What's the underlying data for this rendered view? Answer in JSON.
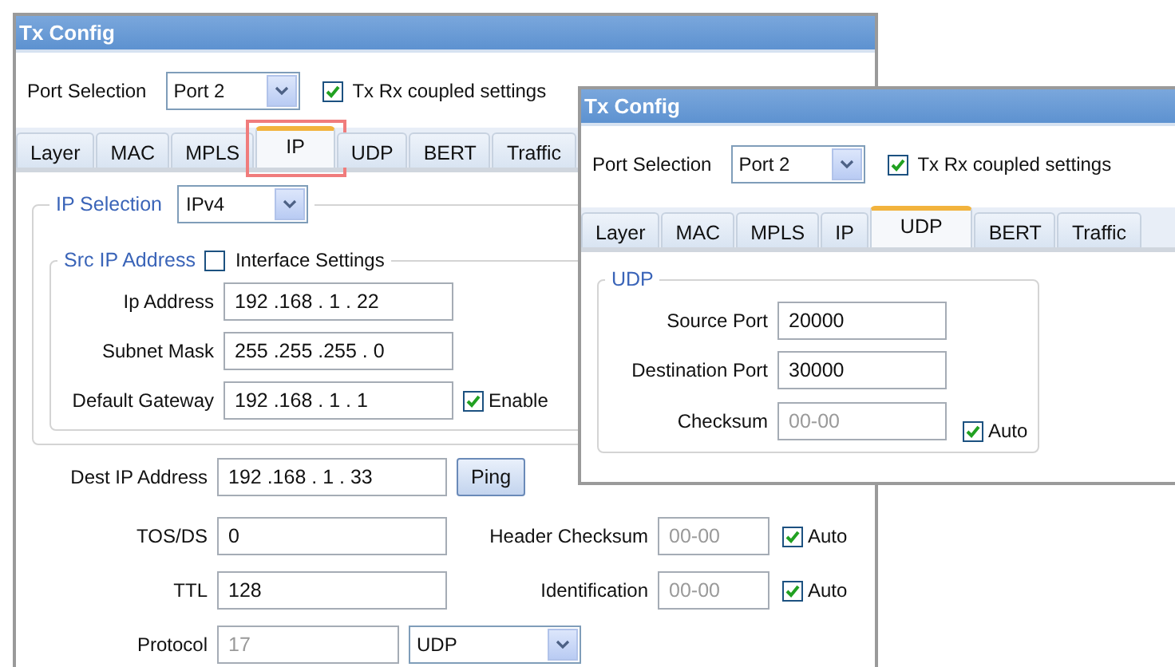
{
  "windows": [
    {
      "title": "Tx Config",
      "port": {
        "label": "Port Selection",
        "value": "Port 2"
      },
      "coupled": {
        "label": "Tx Rx coupled settings",
        "checked": true
      },
      "tabs": [
        {
          "label": "Layer",
          "selected": false
        },
        {
          "label": "MAC",
          "selected": false
        },
        {
          "label": "MPLS",
          "selected": false
        },
        {
          "label": "IP",
          "selected": true
        },
        {
          "label": "UDP",
          "selected": false
        },
        {
          "label": "BERT",
          "selected": false
        },
        {
          "label": "Traffic",
          "selected": false
        }
      ],
      "highlight_selected_tab": true,
      "panel": {
        "kind": "ip",
        "ip_selection": {
          "label": "IP Selection",
          "value": "IPv4"
        },
        "src": {
          "label": "Src IP Address",
          "interface": {
            "label": "Interface Settings",
            "checked": false
          },
          "rows": [
            {
              "label": "Ip Address",
              "value": "192 .168 . 1 . 22"
            },
            {
              "label": "Subnet Mask",
              "value": "255 .255 .255 . 0"
            },
            {
              "label": "Default Gateway",
              "value": "192 .168 . 1 . 1",
              "check": {
                "label": "Enable",
                "checked": true
              }
            }
          ]
        },
        "dest": {
          "label": "Dest IP Address",
          "value": "192 .168 . 1 . 33",
          "button": "Ping"
        },
        "fields": [
          {
            "kind": "input",
            "label": "TOS/DS",
            "value": "0",
            "disabled": false
          },
          {
            "kind": "input",
            "label": "Header Checksum",
            "value": "00-00",
            "disabled": true,
            "check": {
              "label": "Auto",
              "checked": true
            }
          },
          {
            "kind": "input",
            "label": "TTL",
            "value": "128",
            "disabled": false
          },
          {
            "kind": "input",
            "label": "Identification",
            "value": "00-00",
            "disabled": true,
            "check": {
              "label": "Auto",
              "checked": true
            }
          },
          {
            "kind": "input",
            "label": "Protocol",
            "value": "17",
            "disabled": true
          },
          {
            "kind": "select",
            "value": "UDP"
          }
        ]
      }
    },
    {
      "title": "Tx Config",
      "port": {
        "label": "Port Selection",
        "value": "Port 2"
      },
      "coupled": {
        "label": "Tx Rx coupled settings",
        "checked": true
      },
      "tabs": [
        {
          "label": "Layer",
          "selected": false
        },
        {
          "label": "MAC",
          "selected": false
        },
        {
          "label": "MPLS",
          "selected": false
        },
        {
          "label": "IP",
          "selected": false
        },
        {
          "label": "UDP",
          "selected": true
        },
        {
          "label": "BERT",
          "selected": false
        },
        {
          "label": "Traffic",
          "selected": false
        }
      ],
      "panel": {
        "kind": "udp",
        "label": "UDP",
        "fields": [
          {
            "label": "Source Port",
            "value": "20000",
            "disabled": false
          },
          {
            "label": "Destination Port",
            "value": "30000",
            "disabled": false
          },
          {
            "label": "Checksum",
            "value": "00-00",
            "disabled": true,
            "check": {
              "label": "Auto",
              "checked": true
            }
          }
        ]
      }
    }
  ]
}
